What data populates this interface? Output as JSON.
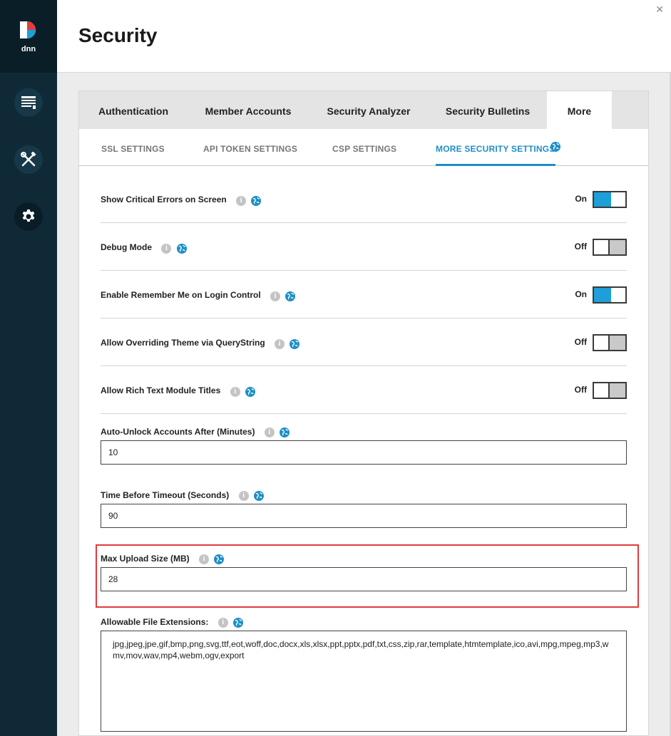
{
  "header": {
    "title": "Security",
    "close_glyph": "✕"
  },
  "sidebar": {
    "logo": "dnn-logo",
    "items": [
      {
        "icon": "content-icon"
      },
      {
        "icon": "tools-icon"
      },
      {
        "icon": "gear-icon",
        "active": true
      }
    ]
  },
  "tabs": [
    {
      "label": "Authentication"
    },
    {
      "label": "Member Accounts"
    },
    {
      "label": "Security Analyzer"
    },
    {
      "label": "Security Bulletins"
    },
    {
      "label": "More",
      "active": true
    }
  ],
  "subtabs": [
    {
      "label": "SSL SETTINGS"
    },
    {
      "label": "API TOKEN SETTINGS"
    },
    {
      "label": "CSP SETTINGS"
    },
    {
      "label": "MORE SECURITY SETTINGS",
      "active": true
    }
  ],
  "toggles": [
    {
      "label": "Show Critical Errors on Screen",
      "state": "On"
    },
    {
      "label": "Debug Mode",
      "state": "Off"
    },
    {
      "label": "Enable Remember Me on Login Control",
      "state": "On"
    },
    {
      "label": "Allow Overriding Theme via QueryString",
      "state": "Off"
    },
    {
      "label": "Allow Rich Text Module Titles",
      "state": "Off"
    }
  ],
  "fields": {
    "auto_unlock": {
      "label": "Auto-Unlock Accounts After (Minutes)",
      "value": "10"
    },
    "timeout": {
      "label": "Time Before Timeout (Seconds)",
      "value": "90"
    },
    "max_upload": {
      "label": "Max Upload Size (MB)",
      "value": "28"
    },
    "extensions": {
      "label": "Allowable File Extensions:",
      "value": "jpg,jpeg,jpe,gif,bmp,png,svg,ttf,eot,woff,doc,docx,xls,xlsx,ppt,pptx,pdf,txt,css,zip,rar,template,htmtemplate,ico,avi,mpg,mpeg,mp3,wmv,mov,wav,mp4,webm,ogv,export"
    }
  },
  "colors": {
    "accent": "#1e9fd9",
    "sidebar": "#0f2a36",
    "highlight": "#e03c3c"
  }
}
